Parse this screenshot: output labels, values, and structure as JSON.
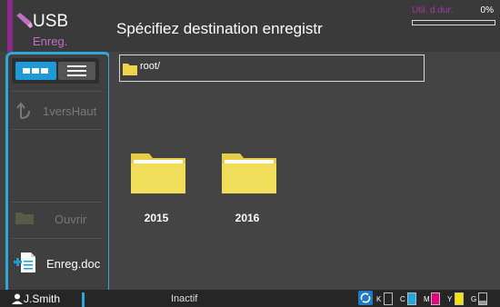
{
  "mode": {
    "title": "USB",
    "subtitle": "Enreg.",
    "accent_color": "#8a2a86",
    "icon": "usb-pen-icon"
  },
  "header": {
    "title": "Spécifiez destination enregistr",
    "disk_usage": {
      "label": "Util. d.dur:",
      "percent_text": "0%",
      "fraction": 0.0,
      "color": "#a43aa0"
    }
  },
  "left_panel": {
    "view_toggle": {
      "options": [
        {
          "name": "grid-view",
          "icon": "grid-icon",
          "selected": true
        },
        {
          "name": "list-view",
          "icon": "list-icon",
          "selected": false
        }
      ]
    },
    "up_button": {
      "label": "1versHaut",
      "icon": "up-arrow-icon",
      "enabled": false
    },
    "open_button": {
      "label": "Ouvrir",
      "icon": "folder-icon",
      "enabled": false
    },
    "save_doc_button": {
      "label": "Enreg.doc",
      "icon": "add-document-icon",
      "enabled": true
    },
    "highlight_color": "#2fa7d9"
  },
  "path_bar": {
    "path": "root/"
  },
  "folders": [
    {
      "name": "2015"
    },
    {
      "name": "2016"
    }
  ],
  "footer": {
    "user": "J.Smith",
    "status": "Inactif",
    "inks": [
      {
        "letter": "K",
        "color": "#111111",
        "level": 0.0
      },
      {
        "letter": "C",
        "color": "#1ea7e1",
        "level": 1.0
      },
      {
        "letter": "M",
        "color": "#e4007f",
        "level": 1.0
      },
      {
        "letter": "Y",
        "color": "#f5e400",
        "level": 1.0
      },
      {
        "letter": "G",
        "color": "#9a9a9a",
        "level": 0.3
      }
    ]
  }
}
